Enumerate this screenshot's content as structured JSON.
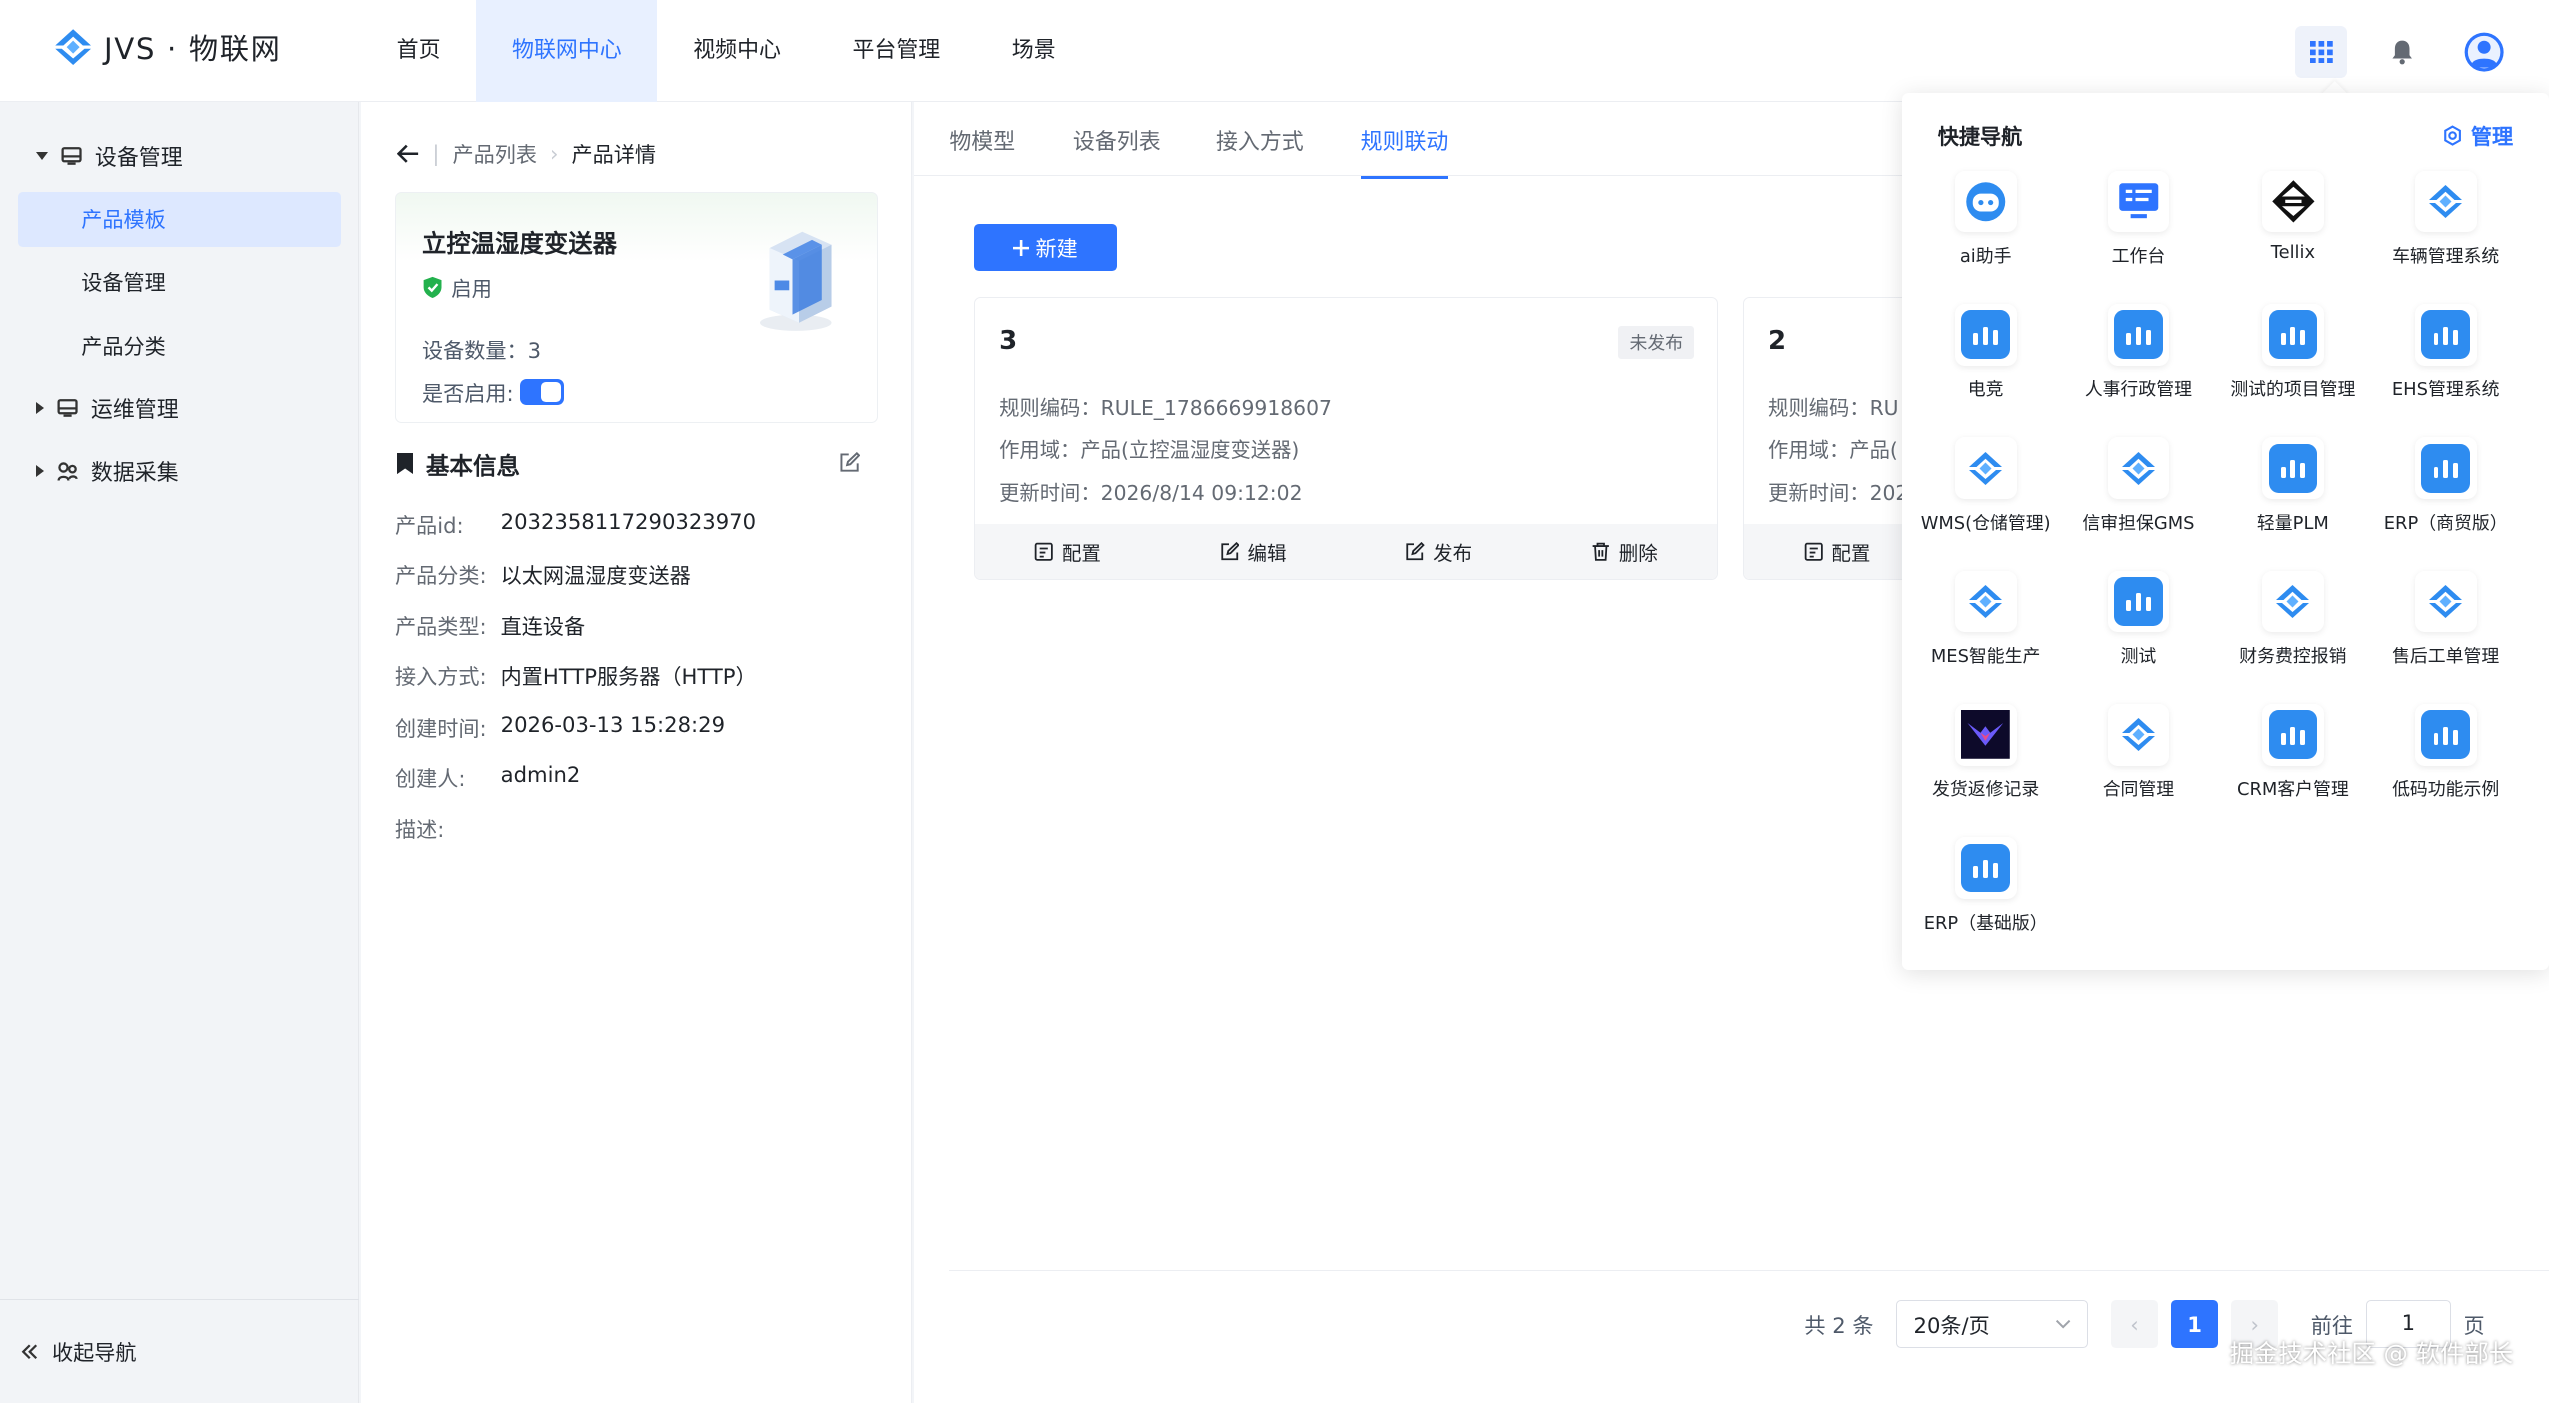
{
  "app": {
    "logo_text": "JVS · 物联网"
  },
  "nav": [
    "首页",
    "物联网中心",
    "视频中心",
    "平台管理",
    "场景"
  ],
  "nav_active": 1,
  "sidebar": {
    "groups": [
      {
        "label": "设备管理",
        "icon": "device-icon",
        "expanded": true,
        "items": [
          "产品模板",
          "设备管理",
          "产品分类"
        ]
      },
      {
        "label": "运维管理",
        "icon": "ops-icon",
        "expanded": false
      },
      {
        "label": "数据采集",
        "icon": "data-collect-icon",
        "expanded": false
      }
    ],
    "active_item": "产品模板",
    "collapse_label": "收起导航"
  },
  "breadcrumb": {
    "parent": "产品列表",
    "current": "产品详情"
  },
  "product": {
    "name": "立控温湿度变送器",
    "status": "启用",
    "device_count_label": "设备数量：",
    "device_count": "3",
    "enable_label": "是否启用:",
    "enabled": true
  },
  "basic_info": {
    "title": "基本信息",
    "rows": [
      {
        "k": "产品id:",
        "v": "2032358117290323970"
      },
      {
        "k": "产品分类:",
        "v": "以太网温湿度变送器"
      },
      {
        "k": "产品类型:",
        "v": "直连设备"
      },
      {
        "k": "接入方式:",
        "v": "内置HTTP服务器（HTTP）"
      },
      {
        "k": "创建时间:",
        "v": "2026-03-13 15:28:29"
      },
      {
        "k": "创建人:",
        "v": "admin2"
      },
      {
        "k": "描述:",
        "v": ""
      }
    ]
  },
  "tabs": [
    "物模型",
    "设备列表",
    "接入方式",
    "规则联动"
  ],
  "tab_active": 3,
  "new_button": "新建",
  "rules": [
    {
      "num": "3",
      "badge": "未发布",
      "code": "规则编码：RULE_1786669918607",
      "scope": "作用域：产品(立控温湿度变送器)",
      "updated": "更新时间：2026/8/14 09:12:02"
    },
    {
      "num": "2",
      "badge": "",
      "code": "规则编码：RU",
      "scope": "作用域：产品(",
      "updated": "更新时间：202"
    }
  ],
  "rule_actions": [
    "配置",
    "编辑",
    "发布",
    "删除"
  ],
  "pagination": {
    "total": "共 2 条",
    "page_size": "20条/页",
    "current_page": "1",
    "goto_label": "前往",
    "goto_value": "1",
    "page_unit": "页"
  },
  "quick_nav": {
    "title": "快捷导航",
    "manage": "管理",
    "apps": [
      {
        "label": "ai助手",
        "icon": "ai-robot-icon"
      },
      {
        "label": "工作台",
        "icon": "workbench-icon"
      },
      {
        "label": "Tellix",
        "icon": "tellix-logo-icon"
      },
      {
        "label": "车辆管理系统",
        "icon": "jvs-logo-icon"
      },
      {
        "label": "电竞",
        "icon": "bar-chart-icon"
      },
      {
        "label": "人事行政管理",
        "icon": "bar-chart-icon"
      },
      {
        "label": "测试的项目管理",
        "icon": "bar-chart-icon"
      },
      {
        "label": "EHS管理系统",
        "icon": "bar-chart-icon"
      },
      {
        "label": "WMS(仓储管理)",
        "icon": "jvs-logo-icon"
      },
      {
        "label": "信审担保GMS",
        "icon": "jvs-logo-icon"
      },
      {
        "label": "轻量PLM",
        "icon": "bar-chart-icon"
      },
      {
        "label": "ERP（商贸版）",
        "icon": "bar-chart-icon"
      },
      {
        "label": "MES智能生产",
        "icon": "jvs-logo-icon"
      },
      {
        "label": "测试",
        "icon": "bar-chart-icon"
      },
      {
        "label": "财务费控报销",
        "icon": "jvs-logo-icon"
      },
      {
        "label": "售后工单管理",
        "icon": "jvs-logo-icon"
      },
      {
        "label": "发货返修记录",
        "icon": "dark-image-icon"
      },
      {
        "label": "合同管理",
        "icon": "jvs-logo-icon"
      },
      {
        "label": "CRM客户管理",
        "icon": "bar-chart-icon"
      },
      {
        "label": "低码功能示例",
        "icon": "bar-chart-icon"
      },
      {
        "label": "ERP（基础版）",
        "icon": "bar-chart-icon"
      }
    ]
  },
  "watermark": "掘金技术社区 @ 软件部长",
  "colors": {
    "primary": "#2e74ff",
    "success": "#23b14d",
    "icon_blue": "#2e8cf0"
  }
}
